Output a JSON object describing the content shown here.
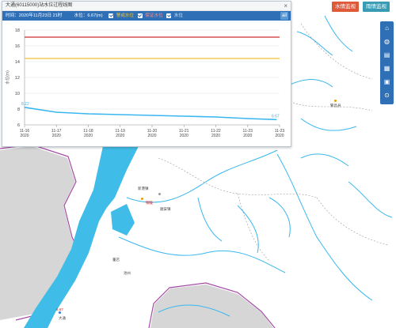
{
  "panel": {
    "title": "大通(60115000)站水位过程线图",
    "close": "×",
    "time_label": "时间：2020年11月23日 21时",
    "level_label": "水位：6.67(m)",
    "legend": {
      "alert": "警戒水位",
      "guarantee": "保证水位",
      "level": "水位"
    },
    "stat_icon": "ail"
  },
  "buttons": {
    "water_monitor": "水情监视",
    "rain_monitor": "雨情监视"
  },
  "tools": [
    "home-icon",
    "globe-icon",
    "layers-icon",
    "document-icon",
    "image-icon",
    "location-icon"
  ],
  "colors": {
    "alert": "#f1c232",
    "guarantee": "#cc2e2e",
    "series": "#3ab7ee",
    "water": "#3fbde8",
    "land": "#d4d4d4"
  },
  "chart_data": {
    "type": "line",
    "ylabel": "水位(m)",
    "ylim": [
      6,
      18
    ],
    "yticks": [
      6,
      8,
      10,
      12,
      14,
      16,
      18
    ],
    "xticks": [
      {
        "d": "11-16",
        "y": "2020"
      },
      {
        "d": "11-17",
        "y": "2020"
      },
      {
        "d": "11-18",
        "y": "2020"
      },
      {
        "d": "11-19",
        "y": "2020"
      },
      {
        "d": "11-20",
        "y": "2020"
      },
      {
        "d": "11-21",
        "y": "2020"
      },
      {
        "d": "11-22",
        "y": "2020"
      },
      {
        "d": "11-23",
        "y": "2020"
      },
      {
        "d": "11-23",
        "y": "2020"
      }
    ],
    "series": [
      {
        "name": "水位",
        "x": [
          0,
          1,
          2,
          3,
          4,
          5,
          6,
          7,
          7.9
        ],
        "values": [
          8.22,
          7.6,
          7.4,
          7.3,
          7.2,
          7.1,
          7.0,
          6.8,
          6.67
        ]
      },
      {
        "name": "警戒水位",
        "values": [
          14.4
        ]
      },
      {
        "name": "保证水位",
        "values": [
          17.1
        ]
      }
    ],
    "start_label": "8.22",
    "end_label": "6.67"
  },
  "map_labels": [
    {
      "text": "新港镇",
      "red": false
    },
    {
      "text": "铜陵",
      "red": true
    },
    {
      "text": "顺安镇",
      "red": false
    },
    {
      "text": "董店",
      "red": false
    },
    {
      "text": "池州",
      "red": false
    },
    {
      "text": "大通",
      "red": false
    },
    {
      "text": "6.67",
      "red": true
    },
    {
      "text": "繁昌县",
      "red": false
    }
  ]
}
